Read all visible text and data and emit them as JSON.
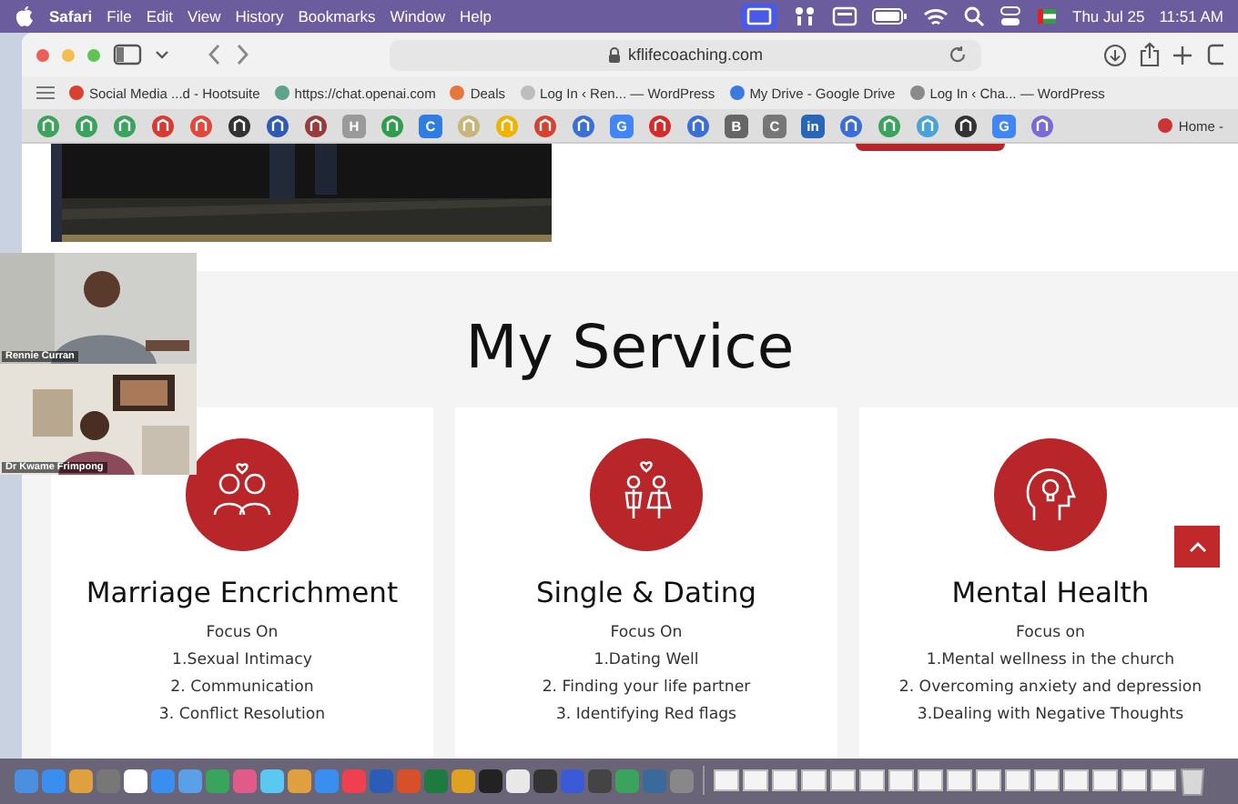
{
  "menu_bar": {
    "app": "Safari",
    "menus": [
      "File",
      "Edit",
      "View",
      "History",
      "Bookmarks",
      "Window",
      "Help"
    ],
    "date": "Thu Jul 25",
    "time": "11:51 AM"
  },
  "browser": {
    "url": "kflifecoaching.com",
    "bookmarks": [
      {
        "label": "Social Media ...d - Hootsuite",
        "color": "#d8402f"
      },
      {
        "label": "https://chat.openai.com",
        "color": "#5aa58c"
      },
      {
        "label": "Deals",
        "color": "#e8763a"
      },
      {
        "label": "Log In ‹ Ren... — WordPress",
        "color": "#bdbdbd"
      },
      {
        "label": "My Drive - Google Drive",
        "color": "#3a7be0"
      },
      {
        "label": "Log In ‹ Cha... — WordPress",
        "color": "#8a8a8a"
      }
    ],
    "pinned_tabs": [
      {
        "kind": "icon",
        "color": "#3aa35c"
      },
      {
        "kind": "icon",
        "color": "#3aa35c"
      },
      {
        "kind": "icon",
        "color": "#3aa35c"
      },
      {
        "kind": "icon",
        "color": "#d63a32"
      },
      {
        "kind": "icon",
        "color": "#e2473a"
      },
      {
        "kind": "icon",
        "color": "#333333"
      },
      {
        "kind": "icon",
        "color": "#2f5bb7"
      },
      {
        "kind": "icon",
        "color": "#9a3a3a"
      },
      {
        "kind": "letter",
        "glyph": "H",
        "color": "#9a9a9a"
      },
      {
        "kind": "icon",
        "color": "#2e9e4a"
      },
      {
        "kind": "letter",
        "glyph": "C",
        "color": "#2f7de0"
      },
      {
        "kind": "icon",
        "color": "#c9b57a"
      },
      {
        "kind": "icon",
        "color": "#f0b400"
      },
      {
        "kind": "icon",
        "color": "#d8402f"
      },
      {
        "kind": "icon",
        "color": "#3a6fd8"
      },
      {
        "kind": "letter",
        "glyph": "G",
        "color": "#4285f4"
      },
      {
        "kind": "icon",
        "color": "#d62a2a"
      },
      {
        "kind": "icon",
        "color": "#3a6fd8"
      },
      {
        "kind": "letter",
        "glyph": "B",
        "color": "#666666"
      },
      {
        "kind": "letter",
        "glyph": "C",
        "color": "#777777"
      },
      {
        "kind": "letter",
        "glyph": "in",
        "color": "#2a66b8"
      },
      {
        "kind": "icon",
        "color": "#3a6fd8"
      },
      {
        "kind": "icon",
        "color": "#3aa35c"
      },
      {
        "kind": "icon",
        "color": "#4aa3d8"
      },
      {
        "kind": "icon",
        "color": "#333333"
      },
      {
        "kind": "letter",
        "glyph": "G",
        "color": "#4285f4"
      },
      {
        "kind": "icon",
        "color": "#7a6ad8"
      }
    ],
    "active_tab": "Home -"
  },
  "video_call": [
    {
      "name": "Rennie Curran"
    },
    {
      "name": "Dr Kwame Frimpong"
    }
  ],
  "page": {
    "heading": "My Service",
    "services": [
      {
        "kind": "couple",
        "title": "Marriage Encrichment",
        "lines": [
          "Focus On",
          "1.Sexual Intimacy",
          "2. Communication",
          "3. Conflict Resolution"
        ]
      },
      {
        "kind": "dating",
        "title": "Single & Dating",
        "lines": [
          "Focus On",
          "1.Dating Well",
          "2. Finding your life partner",
          "3. Identifying Red flags"
        ]
      },
      {
        "kind": "mind",
        "title": "Mental Health",
        "lines": [
          "Focus on",
          "1.Mental wellness in the church",
          "2. Overcoming anxiety and depression",
          "3.Dealing with Negative Thoughts"
        ]
      }
    ]
  }
}
